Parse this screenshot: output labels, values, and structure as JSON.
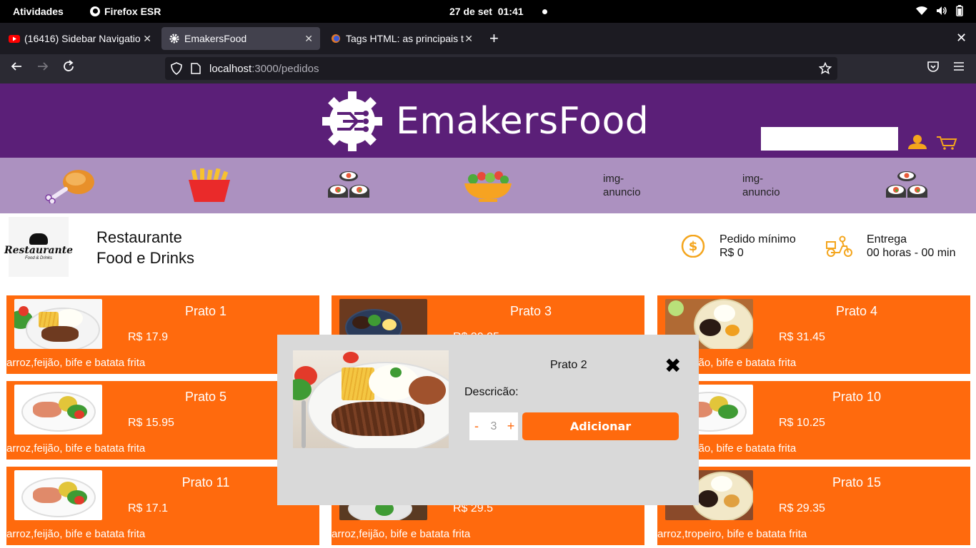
{
  "system": {
    "activities": "Atividades",
    "app_name": "Firefox ESR",
    "date": "27 de set",
    "time": "01:41"
  },
  "browser": {
    "tabs": [
      {
        "label": "(16416) Sidebar Navigatio",
        "icon": "youtube-icon",
        "active": false
      },
      {
        "label": "EmakersFood",
        "icon": "gear-icon",
        "active": true
      },
      {
        "label": "Tags HTML: as principais t",
        "icon": "site-icon",
        "active": false
      }
    ],
    "url_host": "localhost",
    "url_path": ":3000/pedidos"
  },
  "site": {
    "brand_name": "EmakersFood",
    "search_value": "",
    "categories": [
      {
        "kind": "image",
        "icon": "chicken-leg-icon"
      },
      {
        "kind": "image",
        "icon": "fries-icon"
      },
      {
        "kind": "image",
        "icon": "sushi-icon"
      },
      {
        "kind": "image",
        "icon": "salad-bowl-icon"
      },
      {
        "kind": "text",
        "label": "img-anuncio"
      },
      {
        "kind": "text",
        "label": "img-anuncio"
      },
      {
        "kind": "image",
        "icon": "sushi-icon"
      }
    ],
    "restaurant": {
      "logo_word": "Restaurante",
      "logo_sub": "Food & Drinks",
      "name_line1": "Restaurante",
      "name_line2": "Food e Drinks",
      "min_order_label": "Pedido mínimo",
      "min_order_value": "R$ 0",
      "delivery_label": "Entrega",
      "delivery_value": "00 horas - 00 min"
    },
    "products": [
      {
        "name": "Prato 1",
        "price": "R$ 17.9",
        "desc": "arroz,feijão, bife e batata frita"
      },
      {
        "name": "Prato 3",
        "price": "R$ 30.25",
        "desc": ""
      },
      {
        "name": "Prato 4",
        "price": "R$ 31.45",
        "desc": "arroz,feijão, bife e batata frita"
      },
      {
        "name": "Prato 5",
        "price": "R$ 15.95",
        "desc": "arroz,feijão, bife e batata frita"
      },
      {
        "name": "",
        "price": "",
        "desc": ""
      },
      {
        "name": "Prato 10",
        "price": "R$ 10.25",
        "desc": "arroz,feijão, bife e batata frita"
      },
      {
        "name": "Prato 11",
        "price": "R$ 17.1",
        "desc": "arroz,feijão, bife e batata frita"
      },
      {
        "name": "",
        "price": "R$ 29.5",
        "desc": "arroz,feijão, bife e batata frita"
      },
      {
        "name": "Prato 15",
        "price": "R$ 29.35",
        "desc": "arroz,tropeiro, bife e batata frita"
      }
    ],
    "modal": {
      "title": "Prato 2",
      "desc_label": "Descricão:",
      "minus": "-",
      "quantity": "3",
      "plus": "+",
      "add_label": "Adicionar"
    }
  },
  "colors": {
    "header_purple": "#5b1f78",
    "category_lilac": "#ac91c0",
    "card_orange": "#ff6a0d",
    "modal_gray": "#d9d9d9"
  }
}
